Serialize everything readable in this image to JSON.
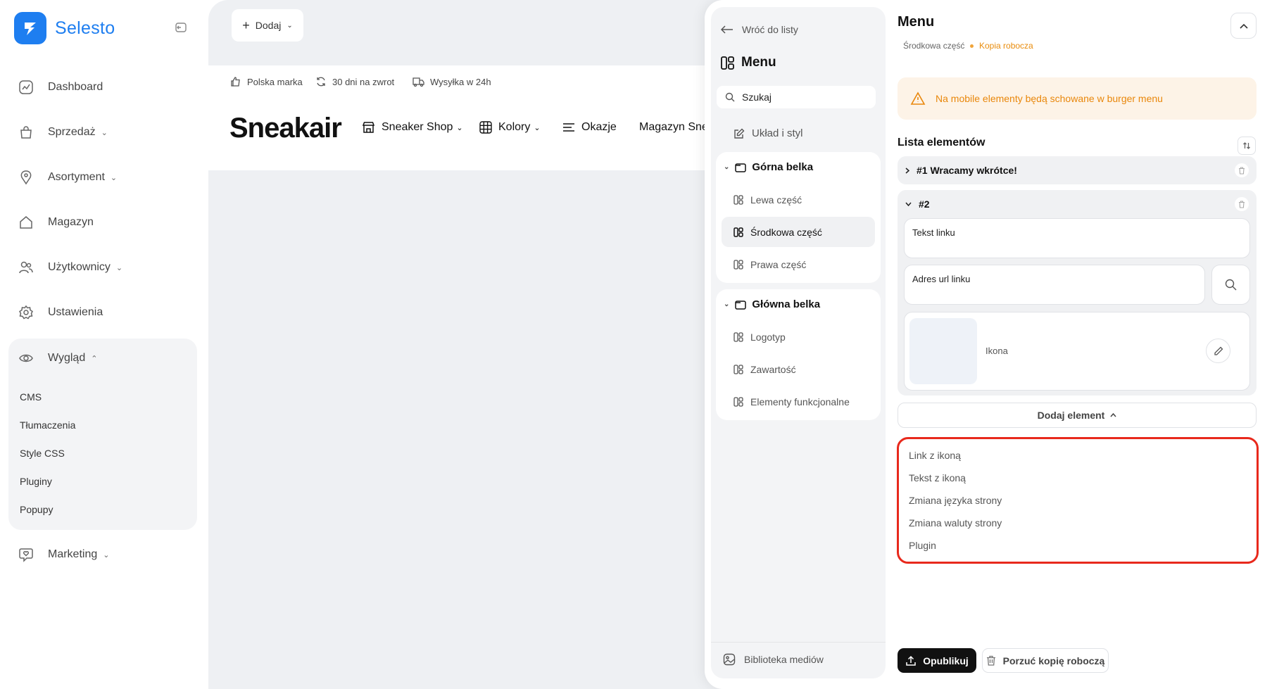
{
  "app": {
    "name": "Selesto"
  },
  "sidebar": {
    "items": [
      {
        "label": "Dashboard",
        "icon": "chart-icon",
        "chevron": ""
      },
      {
        "label": "Sprzedaż",
        "icon": "bag-icon",
        "chevron": "⌄"
      },
      {
        "label": "Asortyment",
        "icon": "tag-icon",
        "chevron": "⌄"
      },
      {
        "label": "Magazyn",
        "icon": "home-icon",
        "chevron": ""
      },
      {
        "label": "Użytkownicy",
        "icon": "users-icon",
        "chevron": "⌄"
      },
      {
        "label": "Ustawienia",
        "icon": "gear-icon",
        "chevron": ""
      },
      {
        "label": "Wygląd",
        "icon": "eye-icon",
        "chevron": "⌃"
      },
      {
        "label": "Marketing",
        "icon": "heart-chat-icon",
        "chevron": "⌄"
      }
    ],
    "wyglad_sub": [
      "CMS",
      "Tłumaczenia",
      "Style CSS",
      "Pluginy",
      "Popupy"
    ]
  },
  "toolbar": {
    "add_label": "Dodaj"
  },
  "preview": {
    "topbar": [
      "Polska marka",
      "30 dni na zwrot",
      "Wysyłka w 24h"
    ],
    "brand": "Sneakair",
    "menu": [
      {
        "label": "Sneaker Shop",
        "chevron": "⌄"
      },
      {
        "label": "Kolory",
        "chevron": "⌄"
      },
      {
        "label": "Okazje",
        "chevron": ""
      },
      {
        "label": "Magazyn Snea",
        "chevron": ""
      }
    ]
  },
  "tree": {
    "back_label": "Wróć do listy",
    "title": "Menu",
    "search_value": "Szukaj",
    "layout_label": "Układ i styl",
    "groups": [
      {
        "label": "Górna belka",
        "children": [
          "Lewa część",
          "Środkowa część",
          "Prawa część"
        ]
      },
      {
        "label": "Główna belka",
        "children": [
          "Logotyp",
          "Zawartość",
          "Elementy funkcjonalne"
        ]
      }
    ],
    "media_label": "Biblioteka mediów"
  },
  "form": {
    "title": "Menu",
    "breadcrumb": "Środkowa część",
    "status": "Kopia robocza",
    "alert": "Na mobile elementy będą schowane w burger menu",
    "list_label": "Lista elementów",
    "items": [
      {
        "label": "#1 Wracamy wkrótce!"
      },
      {
        "label": "#2"
      }
    ],
    "fields": {
      "link_text": "Tekst linku",
      "link_url": "Adres url linku",
      "icon": "Ikona"
    },
    "add_element_label": "Dodaj element",
    "dropdown": [
      "Link z ikoną",
      "Tekst z ikoną",
      "Zmiana języka strony",
      "Zmiana waluty strony",
      "Plugin"
    ],
    "publish_label": "Opublikuj",
    "discard_label": "Porzuć kopię roboczą"
  },
  "colors": {
    "brand": "#1e7ef0",
    "warning": "#e9870b",
    "highlight": "#e8291c"
  }
}
